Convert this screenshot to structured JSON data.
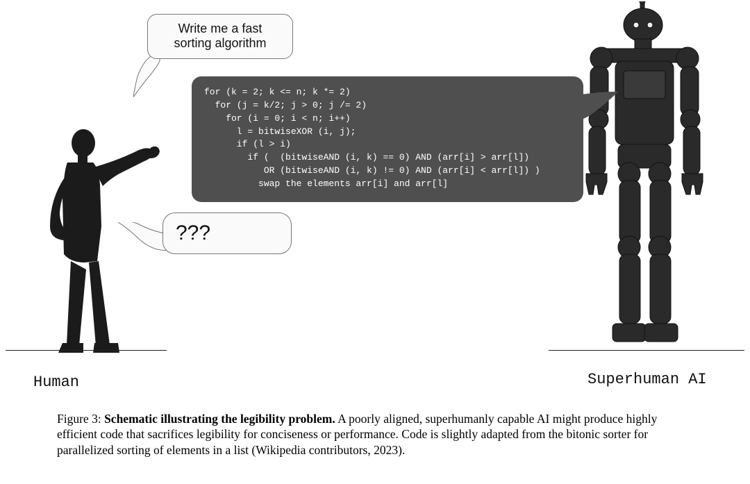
{
  "prompt_bubble": {
    "line1": "Write me a fast",
    "line2": "sorting algorithm"
  },
  "code_bubble": {
    "l1": "for (k = 2; k <= n; k *= 2)",
    "l2": "  for (j = k/2; j > 0; j /= 2)",
    "l3": "    for (i = 0; i < n; i++)",
    "l4": "      l = bitwiseXOR (i, j);",
    "l5": "      if (l > i)",
    "l6": "        if (  (bitwiseAND (i, k) == 0) AND (arr[i] > arr[l])",
    "l7": "           OR (bitwiseAND (i, k) != 0) AND (arr[i] < arr[l]) )",
    "l8": "          swap the elements arr[i] and arr[l]"
  },
  "confused_bubble": {
    "text": "???"
  },
  "labels": {
    "human": "Human",
    "ai": "Superhuman AI"
  },
  "caption": {
    "lead": "Figure 3: ",
    "bold": "Schematic illustrating the legibility problem.",
    "rest": " A poorly aligned, superhumanly capable AI might produce highly efficient code that sacrifices legibility for conciseness or performance. Code is slightly adapted from the bitonic sorter for parallelized sorting of elements in a list (Wikipedia contributors, 2023)."
  }
}
